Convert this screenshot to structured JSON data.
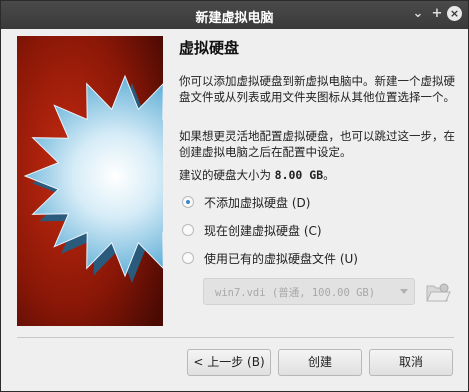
{
  "window": {
    "title": "新建虚拟电脑",
    "controls": {
      "minimize": "⌄",
      "maximize": "+",
      "close": "×"
    }
  },
  "content": {
    "heading": "虚拟硬盘",
    "paragraph1": "你可以添加虚拟硬盘到新虚拟电脑中。新建一个虚拟硬盘文件或从列表或用文件夹图标从其他位置选择一个。",
    "paragraph2": "如果想更灵活地配置虚拟硬盘，也可以跳过这一步，在创建虚拟电脑之后在配置中设定。",
    "size_prefix": "建议的硬盘大小为",
    "size_value": "8.00 GB",
    "size_suffix": "。"
  },
  "options": [
    {
      "label": "不添加虚拟硬盘 (D)",
      "checked": true
    },
    {
      "label": "现在创建虚拟硬盘 (C)",
      "checked": false
    },
    {
      "label": "使用已有的虚拟硬盘文件 (U)",
      "checked": false
    }
  ],
  "disk_select": {
    "value": "win7.vdi (普通, 100.00 GB)",
    "enabled": false
  },
  "buttons": {
    "back": "< 上一步 (B)",
    "create": "创建",
    "cancel": "取消"
  },
  "icons": {
    "folder": "folder-open-icon",
    "image": "virtual-disk-star-graphic"
  }
}
